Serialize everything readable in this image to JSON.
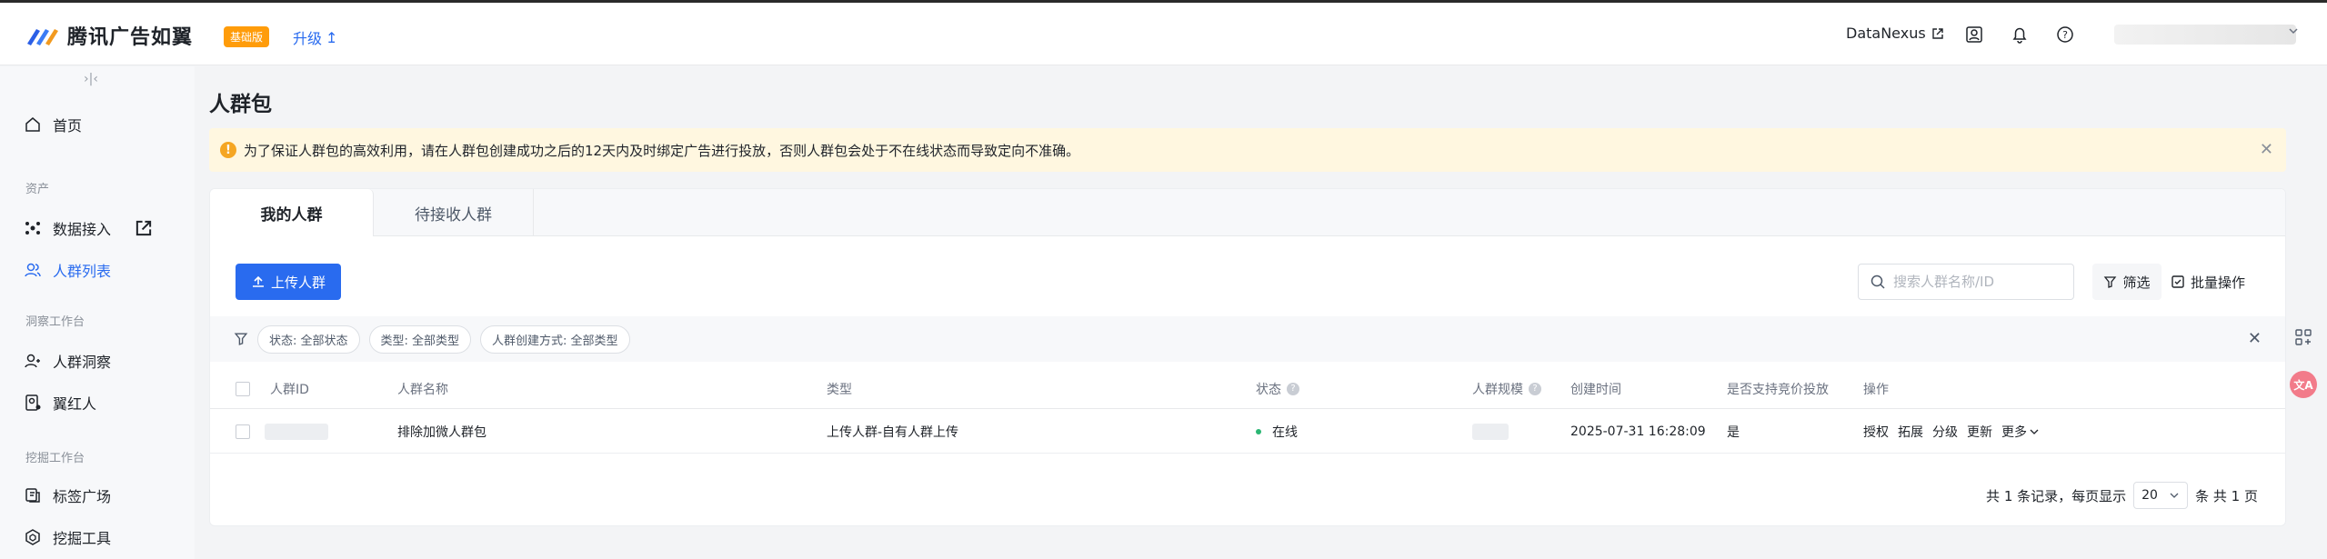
{
  "header": {
    "brand": "腾讯广告如翼",
    "plan_badge": "基础版",
    "upgrade_label": "升级",
    "datanexus_label": "DataNexus",
    "icons": [
      "external-link-icon",
      "user-card-icon",
      "bell-icon",
      "help-icon",
      "chevron-down-icon"
    ]
  },
  "sidebar": {
    "collapse": "›|‹",
    "home": "首页",
    "group_assets": "资产",
    "data_access": "数据接入",
    "audience_list": "人群列表",
    "group_insight": "洞察工作台",
    "audience_insight": "人群洞察",
    "red_people": "翼红人",
    "group_mining": "挖掘工作台",
    "tag_square": "标签广场",
    "mining_tool": "挖掘工具"
  },
  "page": {
    "title": "人群包",
    "notice": "为了保证人群包的高效利用，请在人群包创建成功之后的12天内及时绑定广告进行投放，否则人群包会处于不在线状态而导致定向不准确。"
  },
  "tabs": {
    "mine": "我的人群",
    "pending": "待接收人群"
  },
  "toolbar": {
    "upload": "上传人群",
    "search_placeholder": "搜索人群名称/ID",
    "filter": "筛选",
    "batch": "批量操作"
  },
  "filters": {
    "status": "状态: 全部状态",
    "type": "类型: 全部类型",
    "method": "人群创建方式: 全部类型"
  },
  "table": {
    "columns": {
      "id": "人群ID",
      "name": "人群名称",
      "type": "类型",
      "status": "状态",
      "size": "人群规模",
      "created": "创建时间",
      "bid": "是否支持竞价投放",
      "ops": "操作"
    },
    "rows": [
      {
        "name": "排除加微人群包",
        "type": "上传人群-自有人群上传",
        "status": "在线",
        "created": "2025-07-31 16:28:09",
        "bid": "是",
        "ops": [
          "授权",
          "拓展",
          "分级",
          "更新",
          "更多"
        ]
      }
    ]
  },
  "pagination": {
    "total_text": "共 1 条记录，每页显示",
    "page_size": "20",
    "pages_text": "条 共 1 页"
  },
  "float_tools": {
    "translate": "文A"
  }
}
